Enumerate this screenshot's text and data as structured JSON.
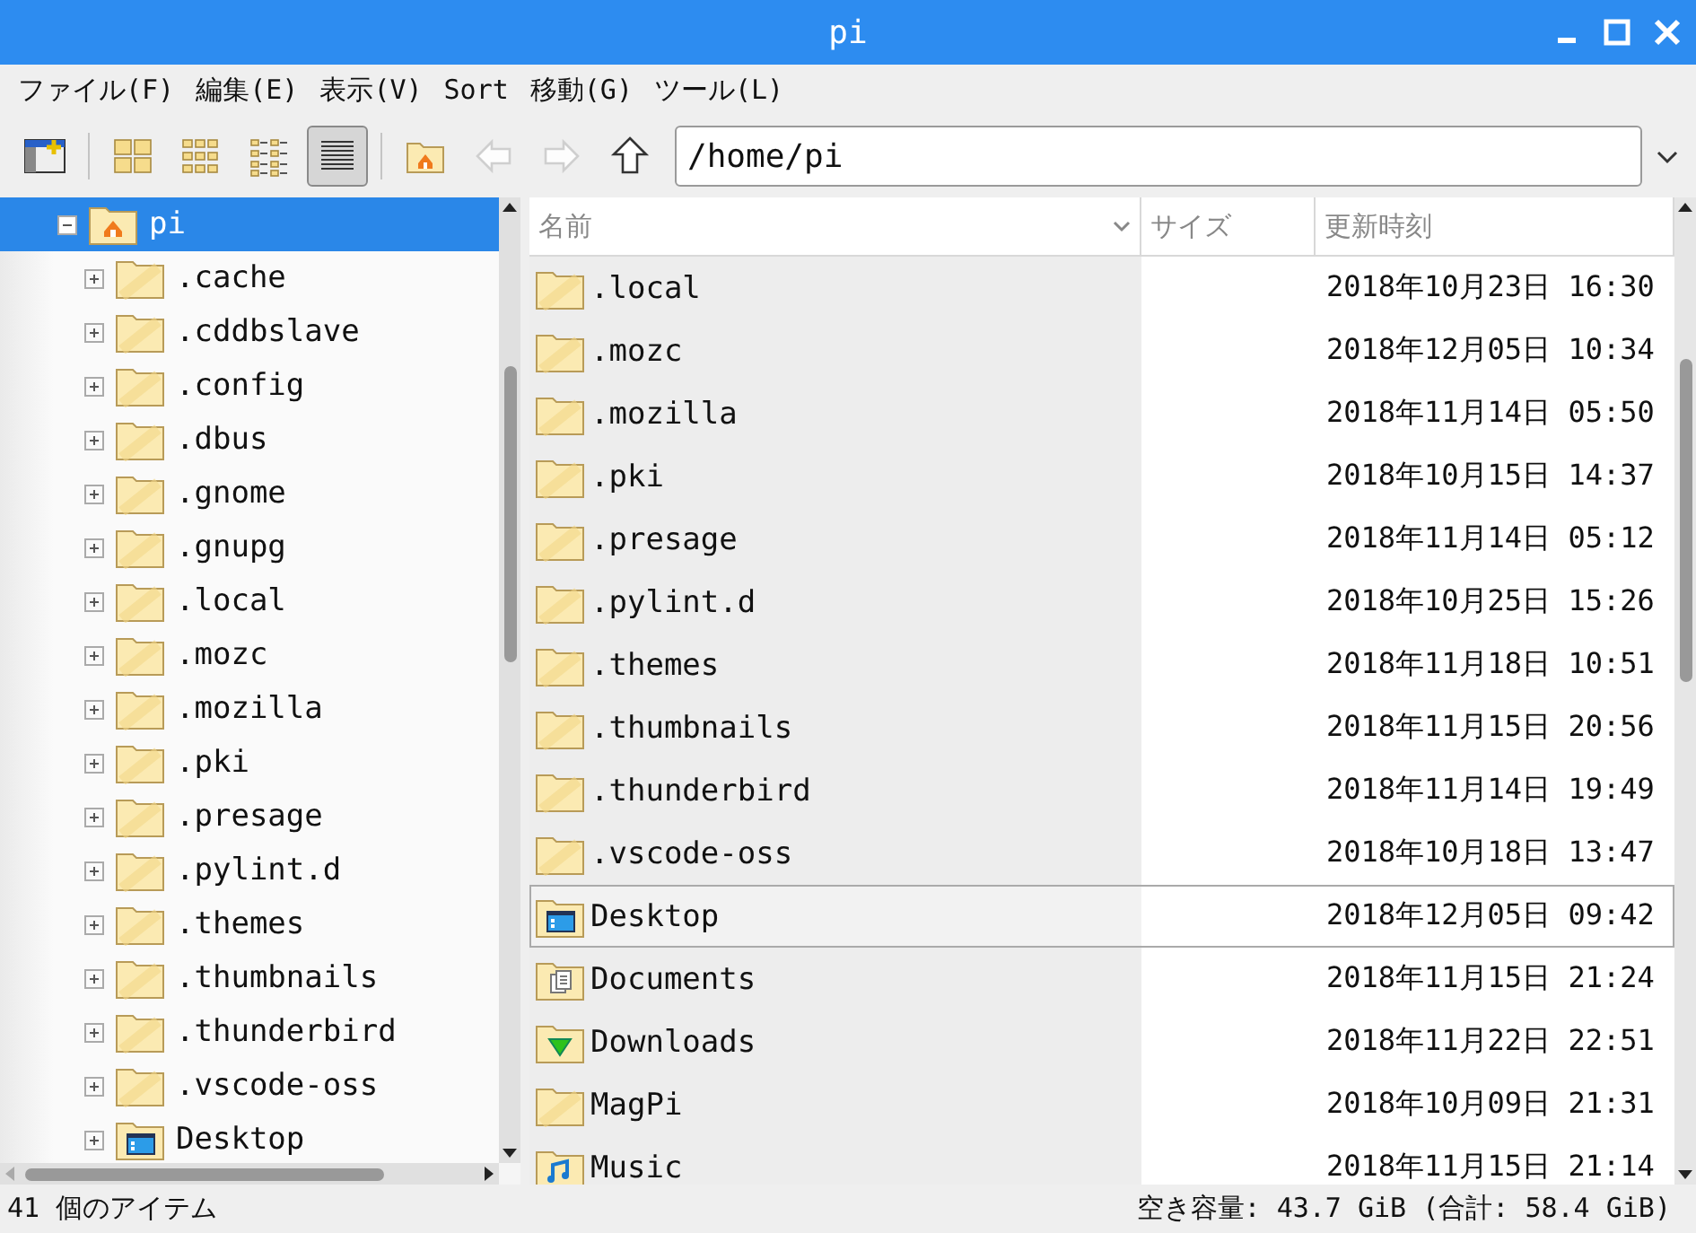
{
  "window": {
    "title": "pi"
  },
  "menu": [
    "ファイル(F)",
    "編集(E)",
    "表示(V)",
    "Sort",
    "移動(G)",
    "ツール(L)"
  ],
  "toolbar": [
    {
      "kind": "new-window",
      "disabled": false,
      "selected": false
    },
    {
      "kind": "separator"
    },
    {
      "kind": "icon-view",
      "disabled": false,
      "selected": false
    },
    {
      "kind": "thumbnail-view",
      "disabled": false,
      "selected": false
    },
    {
      "kind": "compact-view",
      "disabled": false,
      "selected": false
    },
    {
      "kind": "list-view",
      "disabled": false,
      "selected": true
    },
    {
      "kind": "separator"
    },
    {
      "kind": "home",
      "disabled": false,
      "selected": false
    },
    {
      "kind": "back",
      "disabled": true,
      "selected": false
    },
    {
      "kind": "forward",
      "disabled": true,
      "selected": false
    },
    {
      "kind": "up",
      "disabled": false,
      "selected": false
    }
  ],
  "location": {
    "value": "/home/pi"
  },
  "tree": [
    {
      "label": "pi",
      "kind": "home",
      "expanded": true,
      "selected": true,
      "children": [
        {
          "label": ".cache",
          "kind": "folder",
          "expanded": false,
          "selected": false
        },
        {
          "label": ".cddbslave",
          "kind": "folder",
          "expanded": false,
          "selected": false
        },
        {
          "label": ".config",
          "kind": "folder",
          "expanded": false,
          "selected": false
        },
        {
          "label": ".dbus",
          "kind": "folder",
          "expanded": false,
          "selected": false
        },
        {
          "label": ".gnome",
          "kind": "folder",
          "expanded": false,
          "selected": false
        },
        {
          "label": ".gnupg",
          "kind": "folder",
          "expanded": false,
          "selected": false
        },
        {
          "label": ".local",
          "kind": "folder",
          "expanded": false,
          "selected": false
        },
        {
          "label": ".mozc",
          "kind": "folder",
          "expanded": false,
          "selected": false
        },
        {
          "label": ".mozilla",
          "kind": "folder",
          "expanded": false,
          "selected": false
        },
        {
          "label": ".pki",
          "kind": "folder",
          "expanded": false,
          "selected": false
        },
        {
          "label": ".presage",
          "kind": "folder",
          "expanded": false,
          "selected": false
        },
        {
          "label": ".pylint.d",
          "kind": "folder",
          "expanded": false,
          "selected": false
        },
        {
          "label": ".themes",
          "kind": "folder",
          "expanded": false,
          "selected": false
        },
        {
          "label": ".thumbnails",
          "kind": "folder",
          "expanded": false,
          "selected": false
        },
        {
          "label": ".thunderbird",
          "kind": "folder",
          "expanded": false,
          "selected": false
        },
        {
          "label": ".vscode-oss",
          "kind": "folder",
          "expanded": false,
          "selected": false
        },
        {
          "label": "Desktop",
          "kind": "desktop",
          "expanded": false,
          "selected": false
        }
      ]
    }
  ],
  "table": {
    "columns": [
      "名前",
      "サイズ",
      "更新時刻"
    ],
    "rows": [
      {
        "name": ".local",
        "kind": "folder",
        "modified": "2018年10月23日 16:30",
        "selected": false
      },
      {
        "name": ".mozc",
        "kind": "folder",
        "modified": "2018年12月05日 10:34",
        "selected": false
      },
      {
        "name": ".mozilla",
        "kind": "folder",
        "modified": "2018年11月14日 05:50",
        "selected": false
      },
      {
        "name": ".pki",
        "kind": "folder",
        "modified": "2018年10月15日 14:37",
        "selected": false
      },
      {
        "name": ".presage",
        "kind": "folder",
        "modified": "2018年11月14日 05:12",
        "selected": false
      },
      {
        "name": ".pylint.d",
        "kind": "folder",
        "modified": "2018年10月25日 15:26",
        "selected": false
      },
      {
        "name": ".themes",
        "kind": "folder",
        "modified": "2018年11月18日 10:51",
        "selected": false
      },
      {
        "name": ".thumbnails",
        "kind": "folder",
        "modified": "2018年11月15日 20:56",
        "selected": false
      },
      {
        "name": ".thunderbird",
        "kind": "folder",
        "modified": "2018年11月14日 19:49",
        "selected": false
      },
      {
        "name": ".vscode-oss",
        "kind": "folder",
        "modified": "2018年10月18日 13:47",
        "selected": false
      },
      {
        "name": "Desktop",
        "kind": "desktop",
        "modified": "2018年12月05日 09:42",
        "selected": true
      },
      {
        "name": "Documents",
        "kind": "documents",
        "modified": "2018年11月15日 21:24",
        "selected": false
      },
      {
        "name": "Downloads",
        "kind": "downloads",
        "modified": "2018年11月22日 22:51",
        "selected": false
      },
      {
        "name": "MagPi",
        "kind": "folder",
        "modified": "2018年10月09日 21:31",
        "selected": false
      },
      {
        "name": "Music",
        "kind": "music",
        "modified": "2018年11月15日 21:14",
        "selected": false
      }
    ]
  },
  "status_bar": {
    "items": "41 個のアイテム",
    "free_space": "空き容量: 43.7 GiB (合計: 58.4 GiB)"
  }
}
